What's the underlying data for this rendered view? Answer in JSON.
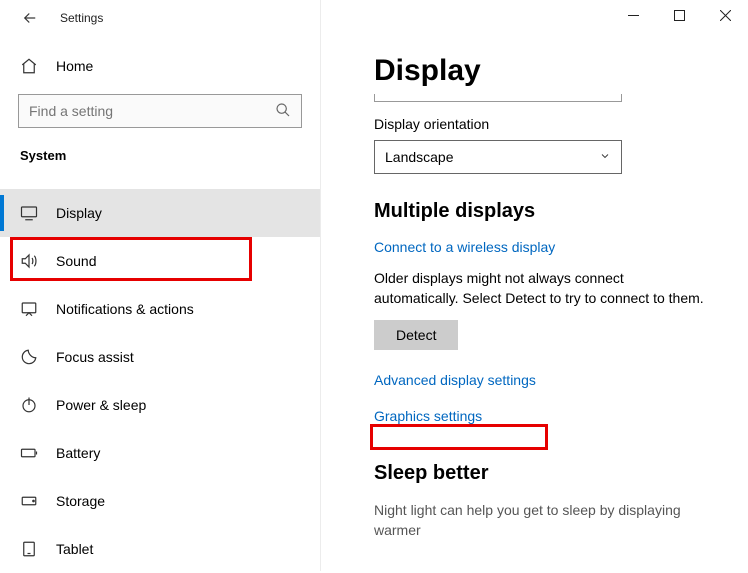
{
  "window": {
    "title": "Settings",
    "controls": {
      "min": "—",
      "max": "▢",
      "close": "✕"
    }
  },
  "sidebar": {
    "home": "Home",
    "search_placeholder": "Find a setting",
    "category": "System",
    "items": [
      {
        "label": "Display",
        "icon": "monitor-icon",
        "active": true
      },
      {
        "label": "Sound",
        "icon": "sound-icon"
      },
      {
        "label": "Notifications & actions",
        "icon": "notifications-icon"
      },
      {
        "label": "Focus assist",
        "icon": "focus-icon"
      },
      {
        "label": "Power & sleep",
        "icon": "power-icon"
      },
      {
        "label": "Battery",
        "icon": "battery-icon"
      },
      {
        "label": "Storage",
        "icon": "storage-icon"
      },
      {
        "label": "Tablet",
        "icon": "tablet-icon"
      }
    ]
  },
  "content": {
    "title": "Display",
    "orientation_label": "Display orientation",
    "orientation_value": "Landscape",
    "multiple_heading": "Multiple displays",
    "wireless_link": "Connect to a wireless display",
    "older_text": "Older displays might not always connect automatically. Select Detect to try to connect to them.",
    "detect_btn": "Detect",
    "advanced_link": "Advanced display settings",
    "graphics_link": "Graphics settings",
    "sleep_heading": "Sleep better",
    "sleep_text": "Night light can help you get to sleep by displaying warmer"
  }
}
